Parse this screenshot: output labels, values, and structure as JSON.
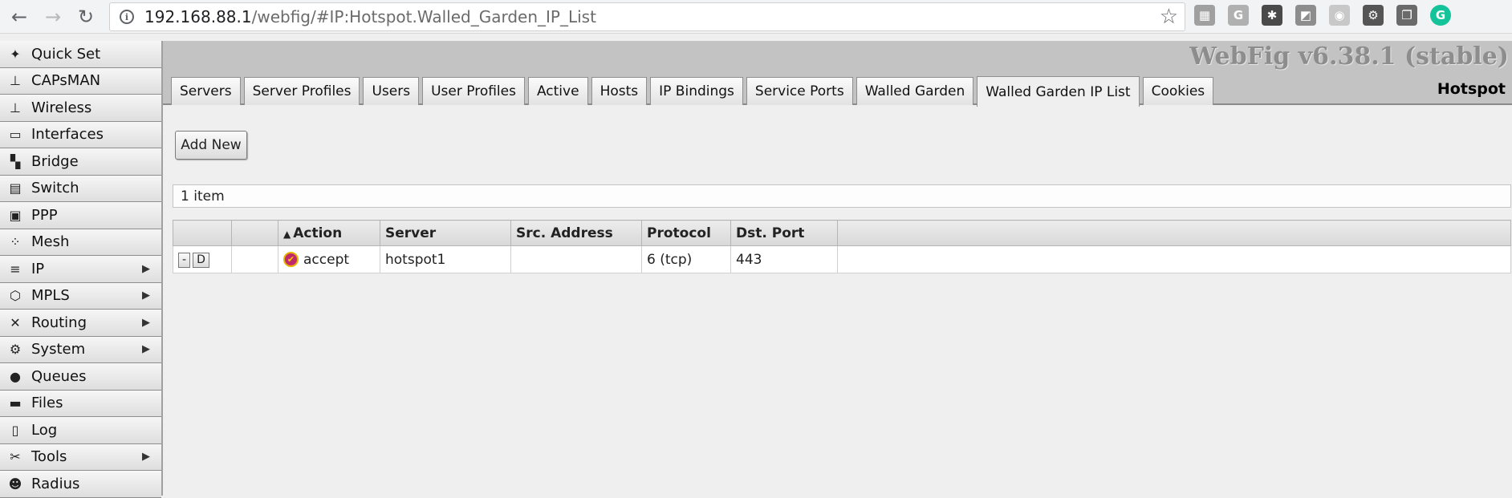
{
  "browser": {
    "url_host": "192.168.88.1",
    "url_path": "/webfig/#IP:Hotspot.Walled_Garden_IP_List",
    "extensions": [
      {
        "name": "calendar-extension-icon",
        "glyph": "▦",
        "color": "#a0a0a0"
      },
      {
        "name": "grammar-g-extension-icon",
        "glyph": "G",
        "color": "#b0b0b0"
      },
      {
        "name": "hubspot-extension-icon",
        "glyph": "✱",
        "color": "#4a4a4a"
      },
      {
        "name": "notes-extension-icon",
        "glyph": "◩",
        "color": "#8d8d8d"
      },
      {
        "name": "camera-extension-icon",
        "glyph": "◉",
        "color": "#c8c8c8"
      },
      {
        "name": "gear-extension-icon",
        "glyph": "⚙",
        "color": "#555555"
      },
      {
        "name": "windows-extension-icon",
        "glyph": "❐",
        "color": "#6a6a6a"
      },
      {
        "name": "grammarly-extension-icon",
        "glyph": "G",
        "color": "#15c39a"
      }
    ]
  },
  "sidebar": {
    "items": [
      {
        "label": "Quick Set",
        "icon": "wand-icon",
        "glyph": "✦",
        "submenu": false
      },
      {
        "label": "CAPsMAN",
        "icon": "antenna-icon",
        "glyph": "⊥",
        "submenu": false
      },
      {
        "label": "Wireless",
        "icon": "wireless-icon",
        "glyph": "⊥",
        "submenu": false
      },
      {
        "label": "Interfaces",
        "icon": "interfaces-icon",
        "glyph": "▭",
        "submenu": false
      },
      {
        "label": "Bridge",
        "icon": "bridge-icon",
        "glyph": "▚",
        "submenu": false
      },
      {
        "label": "Switch",
        "icon": "switch-icon",
        "glyph": "▤",
        "submenu": false
      },
      {
        "label": "PPP",
        "icon": "ppp-icon",
        "glyph": "▣",
        "submenu": false
      },
      {
        "label": "Mesh",
        "icon": "mesh-icon",
        "glyph": "⁘",
        "submenu": false
      },
      {
        "label": "IP",
        "icon": "ip-icon",
        "glyph": "≡",
        "submenu": true
      },
      {
        "label": "MPLS",
        "icon": "mpls-icon",
        "glyph": "⬡",
        "submenu": true
      },
      {
        "label": "Routing",
        "icon": "routing-icon",
        "glyph": "✕",
        "submenu": true
      },
      {
        "label": "System",
        "icon": "system-gear-icon",
        "glyph": "⚙",
        "submenu": true
      },
      {
        "label": "Queues",
        "icon": "queues-icon",
        "glyph": "●",
        "submenu": false
      },
      {
        "label": "Files",
        "icon": "folder-icon",
        "glyph": "▬",
        "submenu": false
      },
      {
        "label": "Log",
        "icon": "log-icon",
        "glyph": "▯",
        "submenu": false
      },
      {
        "label": "Tools",
        "icon": "tools-icon",
        "glyph": "✂",
        "submenu": true
      },
      {
        "label": "Radius",
        "icon": "radius-icon",
        "glyph": "☻",
        "submenu": false
      }
    ],
    "arrow_glyph": "▶"
  },
  "header": {
    "version": "WebFig v6.38.1 (stable)",
    "section_title": "Hotspot"
  },
  "tabs": [
    {
      "label": "Servers",
      "active": false
    },
    {
      "label": "Server Profiles",
      "active": false
    },
    {
      "label": "Users",
      "active": false
    },
    {
      "label": "User Profiles",
      "active": false
    },
    {
      "label": "Active",
      "active": false
    },
    {
      "label": "Hosts",
      "active": false
    },
    {
      "label": "IP Bindings",
      "active": false
    },
    {
      "label": "Service Ports",
      "active": false
    },
    {
      "label": "Walled Garden",
      "active": false
    },
    {
      "label": "Walled Garden IP List",
      "active": true
    },
    {
      "label": "Cookies",
      "active": false
    }
  ],
  "toolbar": {
    "add_new_label": "Add New"
  },
  "list": {
    "count_text": "1 item",
    "columns": [
      "",
      "",
      "Action",
      "Server",
      "Src. Address",
      "Protocol",
      "Dst. Port",
      ""
    ],
    "sort_glyph": "▲",
    "rows": [
      {
        "remove_label": "-",
        "disable_label": "D",
        "flags": "",
        "action": "accept",
        "server": "hotspot1",
        "src_address": "",
        "protocol": "6 (tcp)",
        "dst_port": "443"
      }
    ]
  }
}
